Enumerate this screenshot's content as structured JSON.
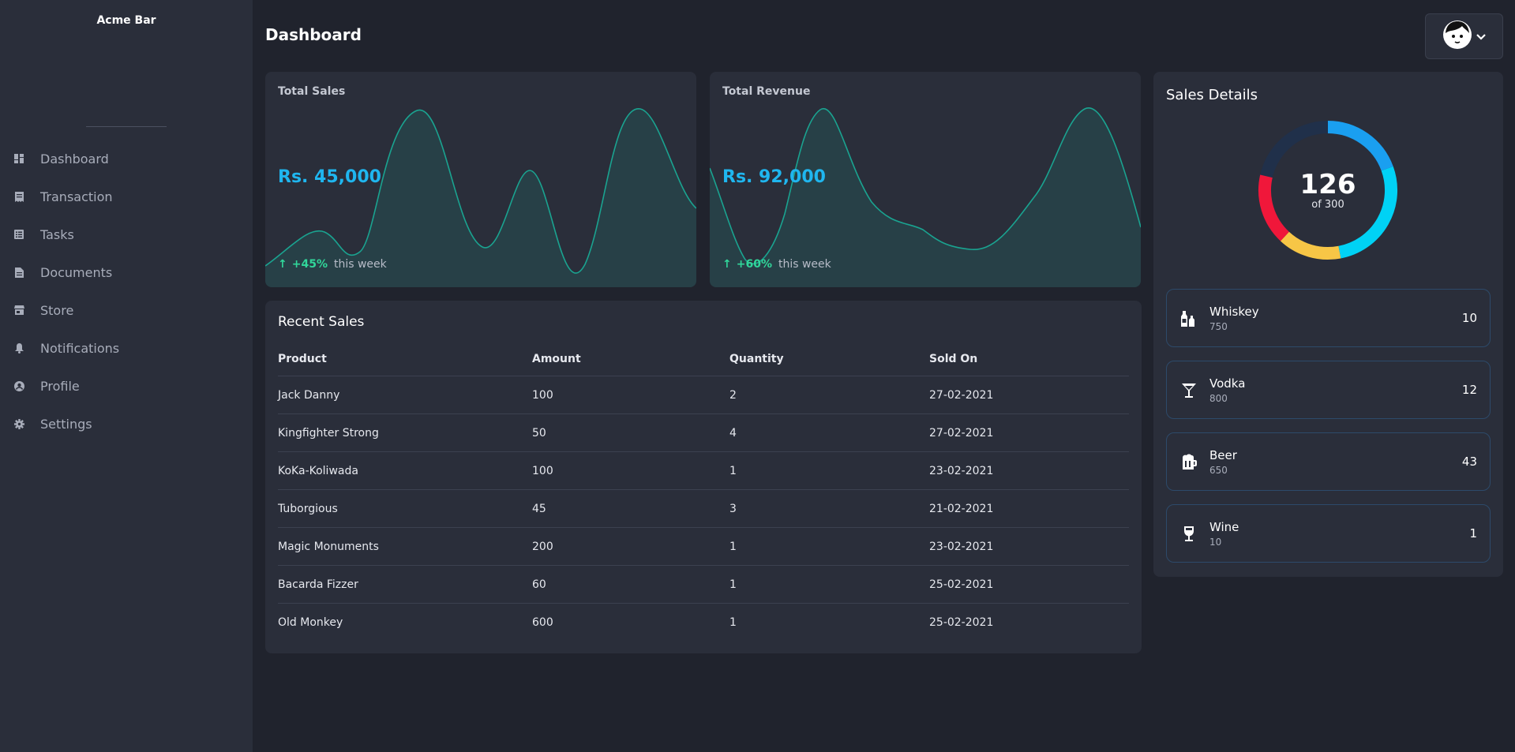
{
  "brand": "Acme Bar",
  "page_title": "Dashboard",
  "nav": [
    {
      "label": "Dashboard",
      "icon": "dashboard-icon"
    },
    {
      "label": "Transaction",
      "icon": "receipt-icon"
    },
    {
      "label": "Tasks",
      "icon": "list-icon"
    },
    {
      "label": "Documents",
      "icon": "document-icon"
    },
    {
      "label": "Store",
      "icon": "store-icon"
    },
    {
      "label": "Notifications",
      "icon": "bell-icon"
    },
    {
      "label": "Profile",
      "icon": "user-icon"
    },
    {
      "label": "Settings",
      "icon": "gear-icon"
    }
  ],
  "cards": {
    "sales": {
      "title": "Total Sales",
      "value": "Rs.  45,000",
      "delta": "+45%",
      "suffix": "this week"
    },
    "revenue": {
      "title": "Total Revenue",
      "value": "Rs.  92,000",
      "delta": "+60%",
      "suffix": "this week"
    }
  },
  "recent": {
    "title": "Recent Sales",
    "columns": [
      "Product",
      "Amount",
      "Quantity",
      "Sold On"
    ],
    "rows": [
      [
        "Jack Danny",
        "100",
        "2",
        "27-02-2021"
      ],
      [
        "Kingfighter Strong",
        "50",
        "4",
        "27-02-2021"
      ],
      [
        "KoKa-Koliwada",
        "100",
        "1",
        "23-02-2021"
      ],
      [
        "Tuborgious",
        "45",
        "3",
        "21-02-2021"
      ],
      [
        "Magic Monuments",
        "200",
        "1",
        "23-02-2021"
      ],
      [
        "Bacarda Fizzer",
        "60",
        "1",
        "25-02-2021"
      ],
      [
        "Old Monkey",
        "600",
        "1",
        "25-02-2021"
      ]
    ]
  },
  "details": {
    "title": "Sales Details",
    "donut_value": "126",
    "donut_sub": "of 300",
    "items": [
      {
        "name": "Whiskey",
        "sub": "750",
        "count": "10",
        "icon": "bottles-icon"
      },
      {
        "name": "Vodka",
        "sub": "800",
        "count": "12",
        "icon": "cocktail-icon"
      },
      {
        "name": "Beer",
        "sub": "650",
        "count": "43",
        "icon": "beer-mug-icon"
      },
      {
        "name": "Wine",
        "sub": "10",
        "count": "1",
        "icon": "wine-glass-icon"
      }
    ]
  },
  "colors": {
    "accent": "#1fb6ef",
    "positive": "#31d69a",
    "chart_line": "#1aa390",
    "donut_blue": "#1a9ff0",
    "donut_cyan": "#00d2f5",
    "donut_yellow": "#f7c646",
    "donut_red": "#f0173a",
    "donut_track": "#20304a"
  }
}
